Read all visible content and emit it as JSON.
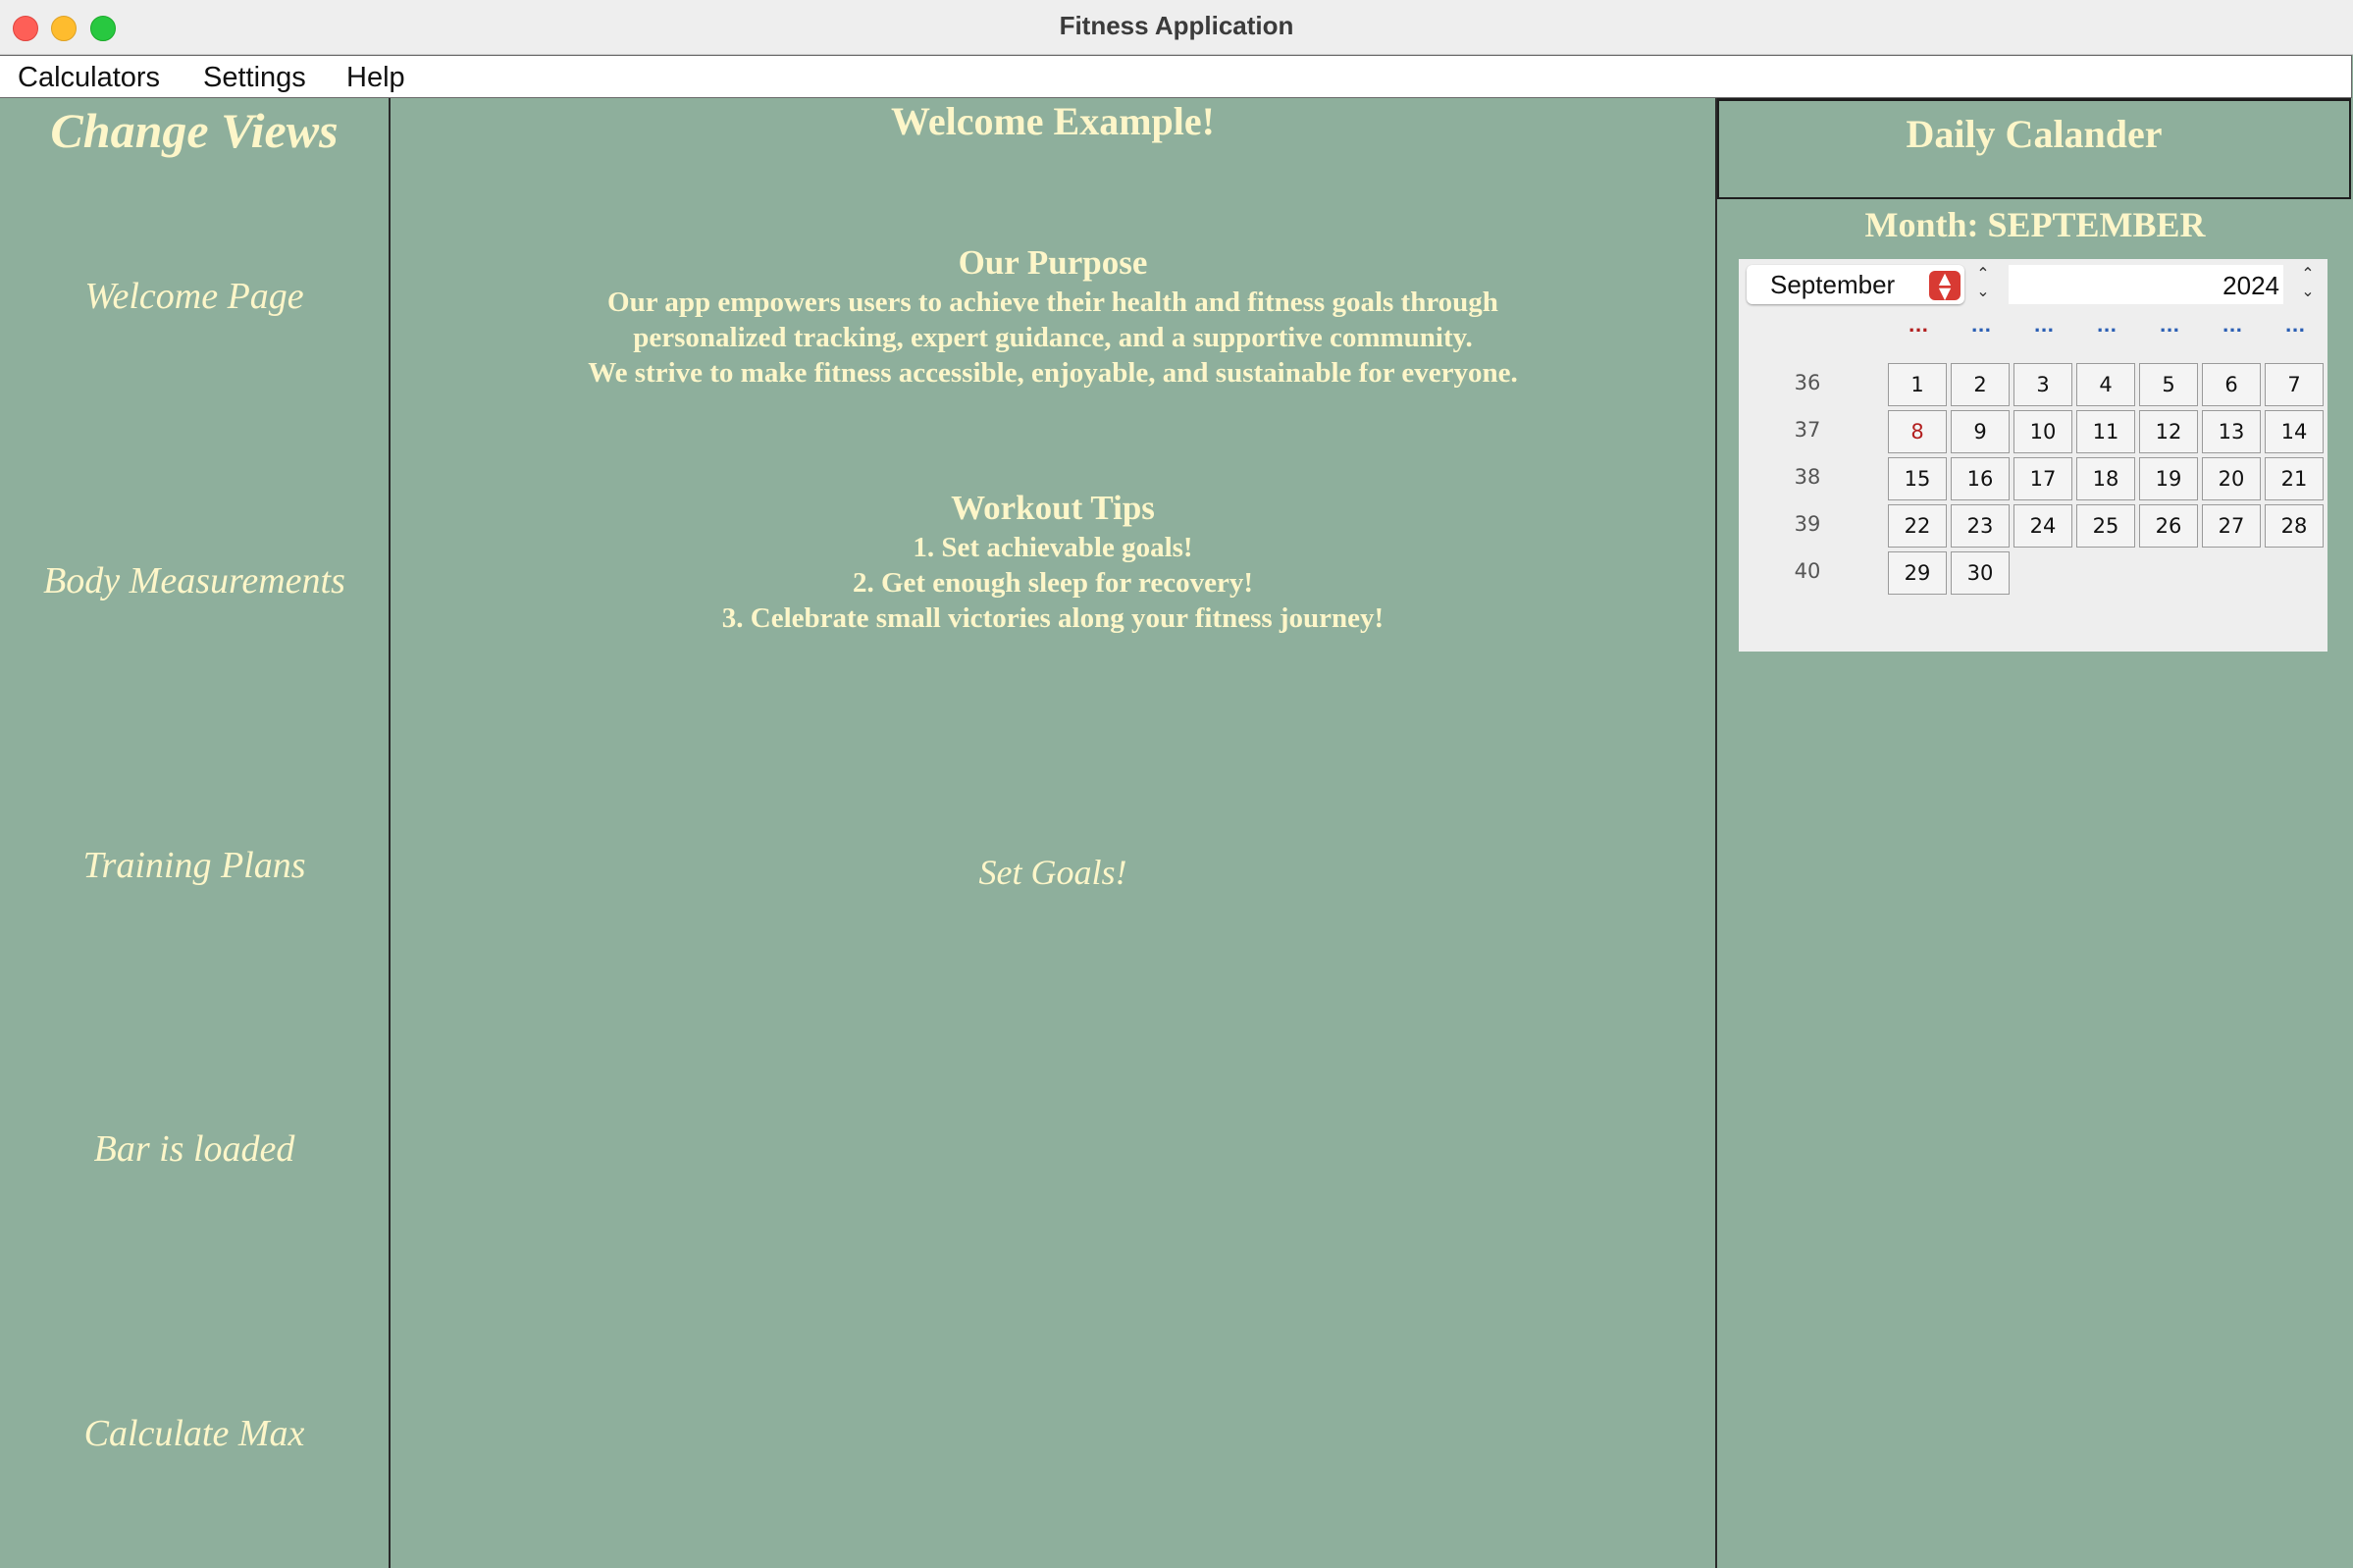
{
  "window": {
    "title": "Fitness Application"
  },
  "menu": {
    "items": [
      "Calculators",
      "Settings",
      "Help"
    ]
  },
  "sidebar": {
    "title": "Change Views",
    "items": [
      "Welcome Page",
      "Body Measurements",
      "Training Plans",
      "Bar is loaded",
      "Calculate Max"
    ]
  },
  "main": {
    "welcome": "Welcome Example!",
    "purpose": {
      "title": "Our Purpose",
      "lines": [
        "Our app empowers users to achieve their health and fitness goals through",
        "personalized tracking, expert guidance, and a supportive community.",
        "We strive to make fitness accessible, enjoyable, and sustainable for everyone."
      ]
    },
    "tips": {
      "title": "Workout Tips",
      "lines": [
        "1. Set achievable goals!",
        "2. Get enough sleep for recovery!",
        "3. Celebrate small victories along your fitness journey!"
      ]
    },
    "set_goals": "Set Goals!"
  },
  "calendar": {
    "header": "Daily Calander",
    "month_label": "Month: SEPTEMBER",
    "month_select": "September",
    "year": "2024",
    "day_headers": [
      "...",
      "...",
      "...",
      "...",
      "...",
      "...",
      "..."
    ],
    "weeks": [
      {
        "num": "36",
        "days": [
          "1",
          "2",
          "3",
          "4",
          "5",
          "6",
          "7"
        ]
      },
      {
        "num": "37",
        "days": [
          "8",
          "9",
          "10",
          "11",
          "12",
          "13",
          "14"
        ]
      },
      {
        "num": "38",
        "days": [
          "15",
          "16",
          "17",
          "18",
          "19",
          "20",
          "21"
        ]
      },
      {
        "num": "39",
        "days": [
          "22",
          "23",
          "24",
          "25",
          "26",
          "27",
          "28"
        ]
      },
      {
        "num": "40",
        "days": [
          "29",
          "30"
        ]
      }
    ],
    "today": "8",
    "colors": {
      "weekend_header": "#b21e1e",
      "weekday_header": "#2b5fb4",
      "today": "#b21e1e"
    }
  },
  "colors": {
    "background": "#8eaf9c",
    "text": "#fdf6c9"
  }
}
